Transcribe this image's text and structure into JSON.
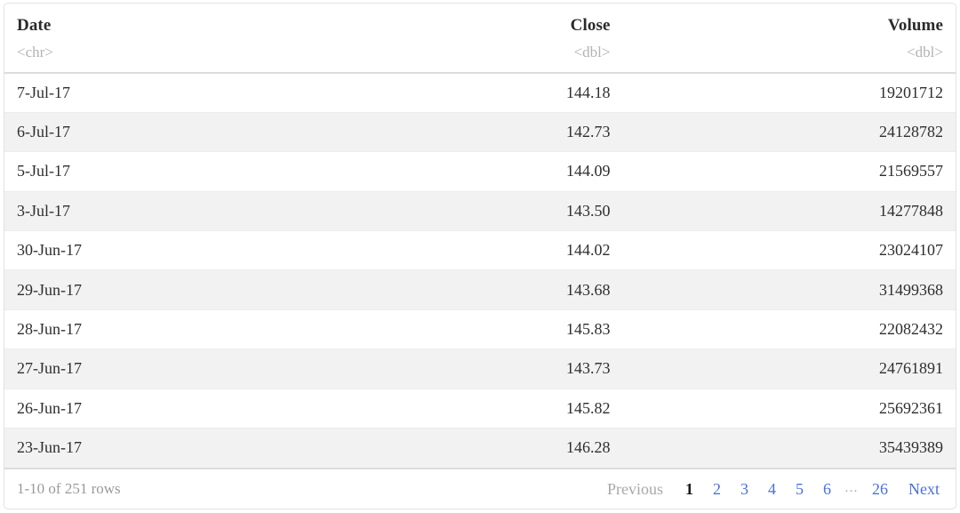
{
  "table": {
    "columns": [
      {
        "label": "Date",
        "type": "<chr>",
        "align": "left"
      },
      {
        "label": "Close",
        "type": "<dbl>",
        "align": "right"
      },
      {
        "label": "Volume",
        "type": "<dbl>",
        "align": "right"
      }
    ],
    "rows": [
      {
        "date": "7-Jul-17",
        "close": "144.18",
        "volume": "19201712"
      },
      {
        "date": "6-Jul-17",
        "close": "142.73",
        "volume": "24128782"
      },
      {
        "date": "5-Jul-17",
        "close": "144.09",
        "volume": "21569557"
      },
      {
        "date": "3-Jul-17",
        "close": "143.50",
        "volume": "14277848"
      },
      {
        "date": "30-Jun-17",
        "close": "144.02",
        "volume": "23024107"
      },
      {
        "date": "29-Jun-17",
        "close": "143.68",
        "volume": "31499368"
      },
      {
        "date": "28-Jun-17",
        "close": "145.83",
        "volume": "22082432"
      },
      {
        "date": "27-Jun-17",
        "close": "143.73",
        "volume": "24761891"
      },
      {
        "date": "26-Jun-17",
        "close": "145.82",
        "volume": "25692361"
      },
      {
        "date": "23-Jun-17",
        "close": "146.28",
        "volume": "35439389"
      }
    ]
  },
  "footer": {
    "row_info": "1-10 of 251 rows",
    "previous_label": "Previous",
    "next_label": "Next",
    "ellipsis": "…",
    "pages": [
      "1",
      "2",
      "3",
      "4",
      "5",
      "6"
    ],
    "last_page": "26",
    "current_page": "1"
  },
  "colors": {
    "link": "#4a6fe0",
    "muted": "#9a9a9a",
    "text": "#2e2e2e",
    "stripe": "#f2f2f2",
    "border": "#dcdcdc"
  }
}
